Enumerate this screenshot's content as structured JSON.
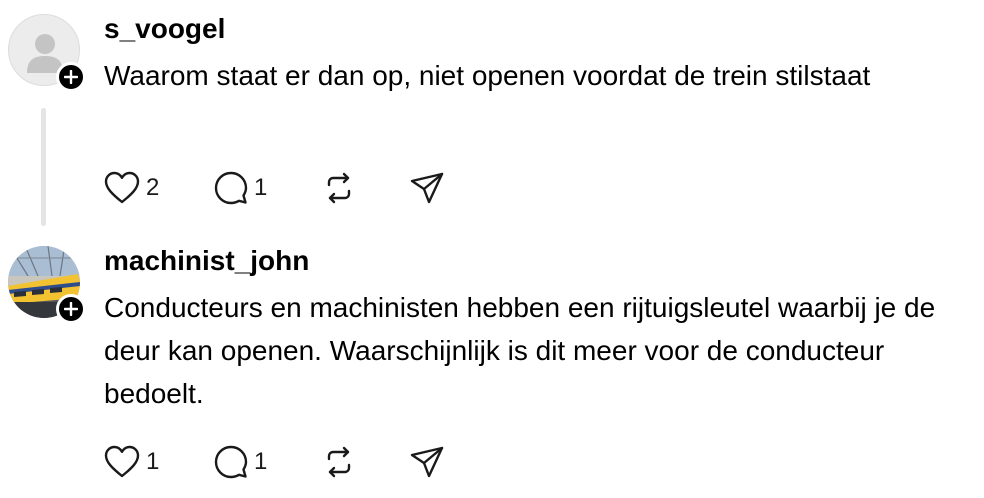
{
  "posts": [
    {
      "username": "s_voogel",
      "text": "Waarom staat er dan op, niet openen voordat de trein stilstaat",
      "likes": "2",
      "replies": "1",
      "avatar": "default-user-icon",
      "has_thread_line": true
    },
    {
      "username": "machinist_john",
      "text": "Conducteurs en machinisten hebben een rijtuigsleutel waarbij je de deur kan openen. Waarschijnlijk is dit meer voor de conducteur bedoelt.",
      "likes": "1",
      "replies": "1",
      "avatar": "train-photo",
      "has_thread_line": false
    }
  ],
  "icons": {
    "like": "heart-icon",
    "reply": "speech-bubble-icon",
    "repost": "repost-icon",
    "share": "paper-plane-icon",
    "follow": "plus-icon"
  },
  "colors": {
    "text": "#000000",
    "thread_line": "#e4e4e4",
    "badge": "#000000"
  }
}
